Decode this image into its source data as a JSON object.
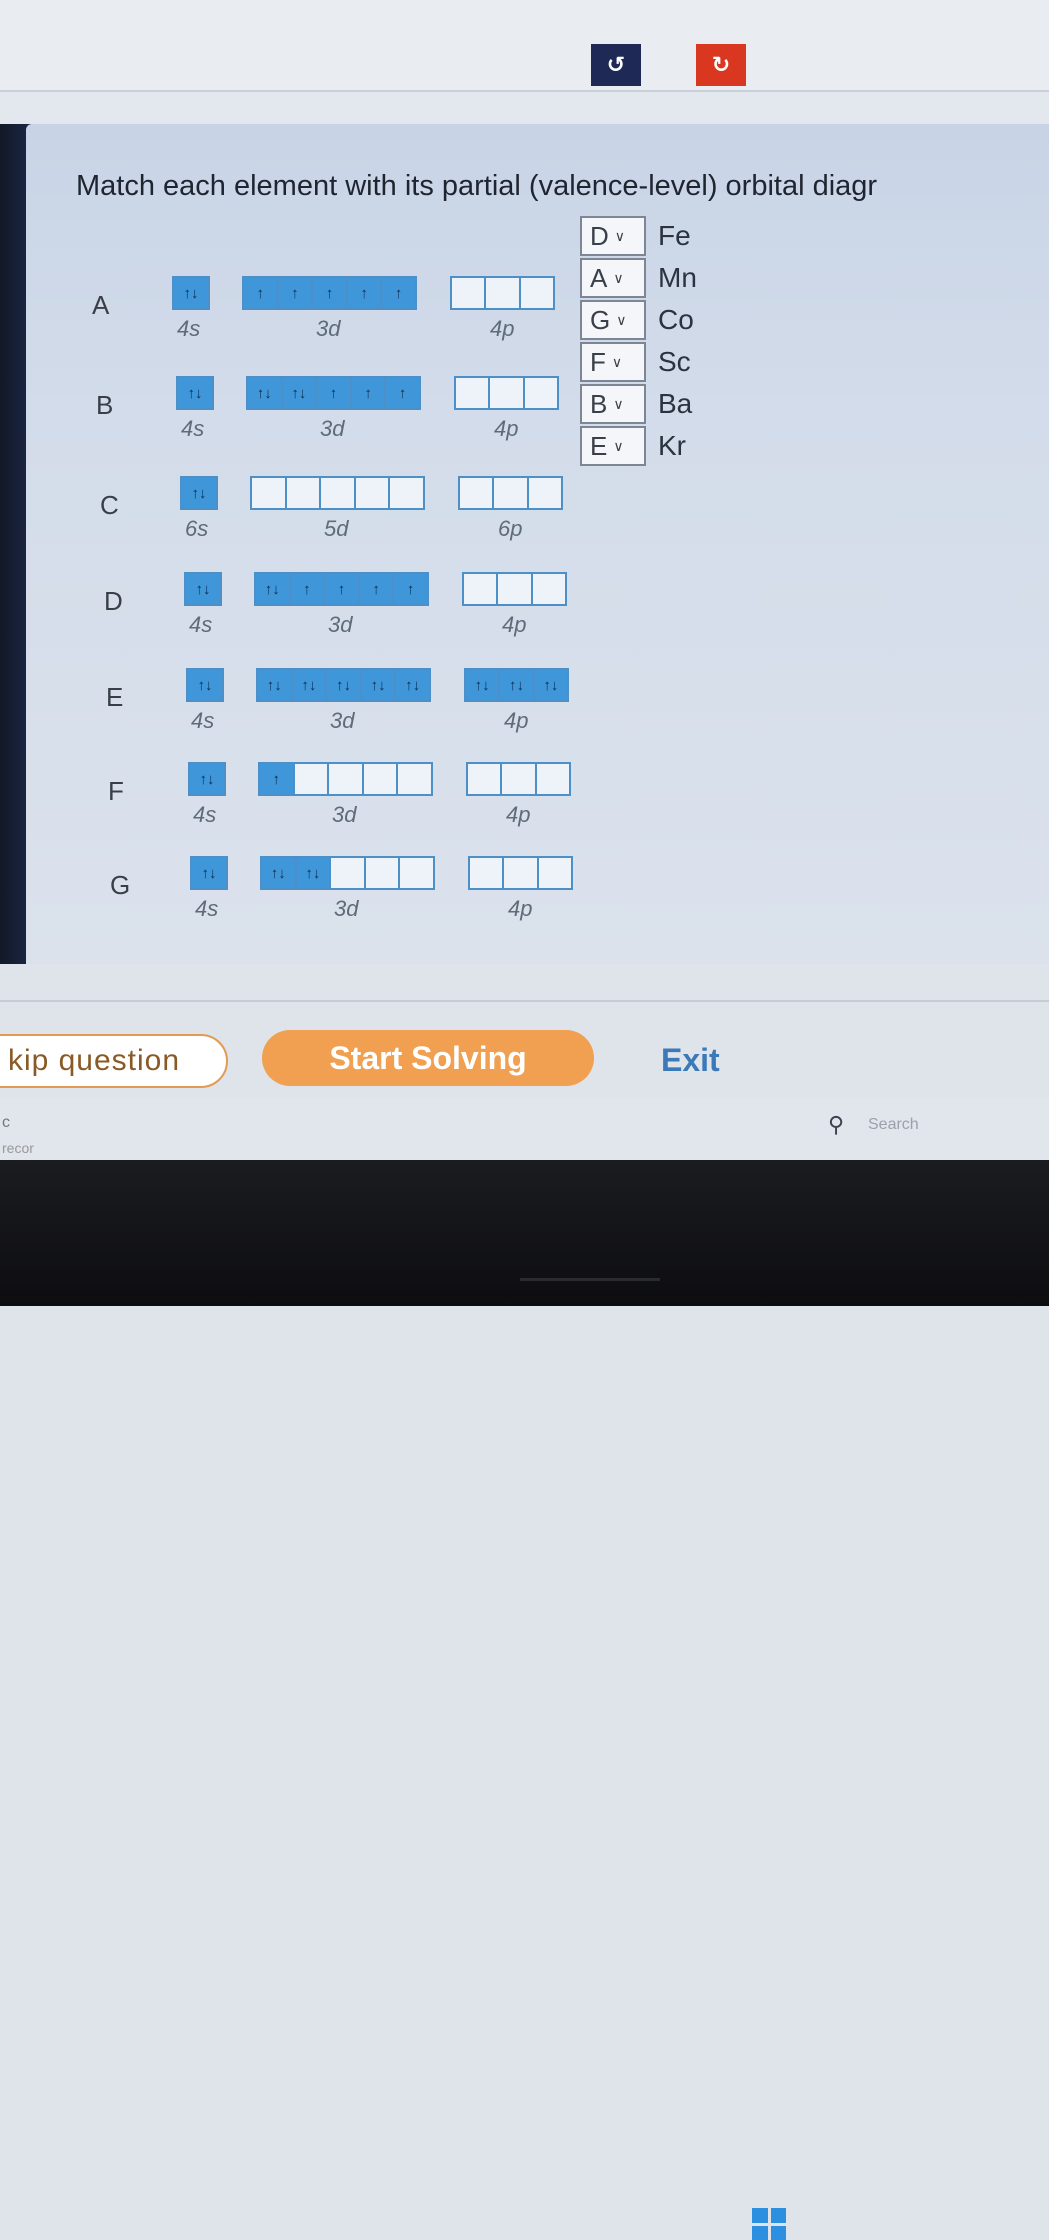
{
  "toolbar": {
    "undo_icon": "↺",
    "redo_icon": "↻"
  },
  "prompt": "Match each element with its partial (valence-level) orbital diagr",
  "rows": [
    {
      "letter": "A",
      "s_label": "4s",
      "d_label": "3d",
      "p_label": "4p",
      "s": [
        "↑↓"
      ],
      "d": [
        "↑",
        "↑",
        "↑",
        "↑",
        "↑"
      ],
      "p": [
        "",
        "",
        ""
      ]
    },
    {
      "letter": "B",
      "s_label": "4s",
      "d_label": "3d",
      "p_label": "4p",
      "s": [
        "↑↓"
      ],
      "d": [
        "↑↓",
        "↑↓",
        "↑",
        "↑",
        "↑"
      ],
      "p": [
        "",
        "",
        ""
      ]
    },
    {
      "letter": "C",
      "s_label": "6s",
      "d_label": "5d",
      "p_label": "6p",
      "s": [
        "↑↓"
      ],
      "d": [
        "",
        "",
        "",
        "",
        ""
      ],
      "p": [
        "",
        "",
        ""
      ]
    },
    {
      "letter": "D",
      "s_label": "4s",
      "d_label": "3d",
      "p_label": "4p",
      "s": [
        "↑↓"
      ],
      "d": [
        "↑↓",
        "↑",
        "↑",
        "↑",
        "↑"
      ],
      "p": [
        "",
        "",
        ""
      ]
    },
    {
      "letter": "E",
      "s_label": "4s",
      "d_label": "3d",
      "p_label": "4p",
      "s": [
        "↑↓"
      ],
      "d": [
        "↑↓",
        "↑↓",
        "↑↓",
        "↑↓",
        "↑↓"
      ],
      "p": [
        "↑↓",
        "↑↓",
        "↑↓"
      ]
    },
    {
      "letter": "F",
      "s_label": "4s",
      "d_label": "3d",
      "p_label": "4p",
      "s": [
        "↑↓"
      ],
      "d": [
        "↑",
        "",
        "",
        "",
        ""
      ],
      "p": [
        "",
        "",
        ""
      ]
    },
    {
      "letter": "G",
      "s_label": "4s",
      "d_label": "3d",
      "p_label": "4p",
      "s": [
        "↑↓"
      ],
      "d": [
        "↑↓",
        "↑↓",
        "",
        "",
        ""
      ],
      "p": [
        "",
        "",
        ""
      ]
    }
  ],
  "matches": [
    {
      "selected": "D",
      "element": "Fe"
    },
    {
      "selected": "A",
      "element": "Mn"
    },
    {
      "selected": "G",
      "element": "Co"
    },
    {
      "selected": "F",
      "element": "Sc"
    },
    {
      "selected": "B",
      "element": "Ba"
    },
    {
      "selected": "E",
      "element": "Kr"
    }
  ],
  "footer": {
    "skip_label": "kip question",
    "start_label": "Start Solving",
    "exit_label": "Exit"
  },
  "taskbar": {
    "search_icon": "⚲",
    "search_placeholder": "Search",
    "tiny_left": "c",
    "tiny_left2": "recor"
  },
  "colors": {
    "filled_cell": "#3f97d9",
    "start_button": "#f0a050",
    "redo_button": "#d9371f",
    "undo_button": "#1e2a55"
  }
}
